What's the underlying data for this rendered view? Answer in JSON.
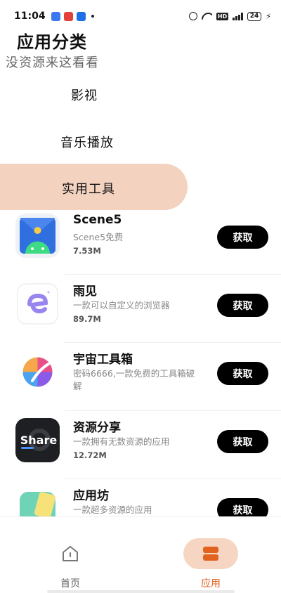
{
  "status_bar": {
    "time": "11:04",
    "notification_icons": [
      "app-icon",
      "red-app-icon",
      "alipay-icon"
    ],
    "network_type": "HD",
    "battery": "24"
  },
  "header": {
    "title": "应用分类",
    "subtitle": "没资源来这看看"
  },
  "categories": [
    {
      "label": "影视",
      "selected": false
    },
    {
      "label": "音乐播放",
      "selected": false
    },
    {
      "label": "实用工具",
      "selected": true
    }
  ],
  "apps": [
    {
      "name": "Scene5",
      "desc": "Scene5免费",
      "size": "7.53M",
      "button": "获取",
      "icon": "scene5-icon"
    },
    {
      "name": "雨见",
      "desc": "一款可以自定义的浏览器",
      "size": "89.7M",
      "button": "获取",
      "icon": "yujian-browser-icon"
    },
    {
      "name": "宇宙工具箱",
      "desc": "密码6666,一款免费的工具箱破解",
      "size": "",
      "button": "获取",
      "icon": "universe-toolbox-icon"
    },
    {
      "name": "资源分享",
      "desc": "一款拥有无数资源的应用",
      "size": "12.72M",
      "button": "获取",
      "icon": "share-icon"
    },
    {
      "name": "应用坊",
      "desc": "一款超多资源的应用",
      "size": "",
      "button": "获取",
      "icon": "app-workshop-icon"
    }
  ],
  "bottom_nav": {
    "home_label": "首页",
    "apps_label": "应用",
    "active": "应用"
  },
  "colors": {
    "accent": "#e2621f",
    "selected_pill": "#f3d2c0",
    "button_bg": "#000000"
  }
}
